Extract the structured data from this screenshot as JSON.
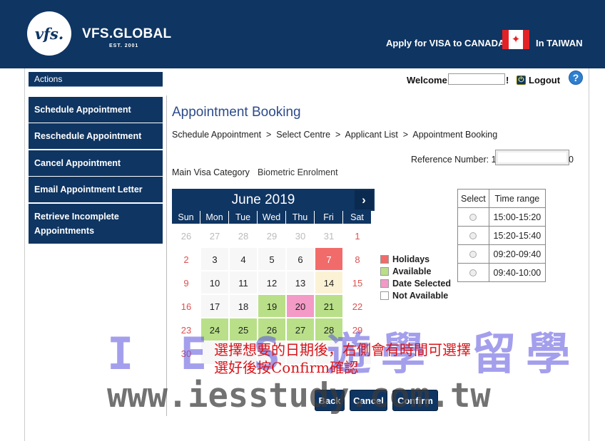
{
  "header": {
    "logo_text": "vfs.",
    "brand": "VFS.GLOBAL",
    "brand_sub": "EST. 2001",
    "apply_text": "Apply for VISA to CANADA",
    "flag_glyph": "✦",
    "in_text": "In TAIWAN",
    "bg_color": "#0f3562"
  },
  "sidebar": {
    "heading": "Actions",
    "items": [
      {
        "label": "Schedule Appointment"
      },
      {
        "label": "Reschedule Appointment"
      },
      {
        "label": "Cancel Appointment"
      },
      {
        "label": "Email Appointment Letter"
      },
      {
        "label": "Retrieve Incomplete Appointments"
      }
    ]
  },
  "topbar": {
    "welcome": "Welcome",
    "exclaim": "!",
    "logout_icon": "power-icon",
    "logout_glyph": "⏻",
    "logout": "Logout",
    "help_glyph": "?"
  },
  "page": {
    "title": "Appointment Booking",
    "breadcrumb": "Schedule Appointment  >  Select Centre  >  Applicant List  >  Appointment Booking",
    "reference_label": "Reference Number:",
    "reference_prefix": "1",
    "reference_suffix": "0",
    "main_visa_label": "Main Visa Category",
    "main_visa_value": "Biometric Enrolment"
  },
  "calendar": {
    "month": "June 2019",
    "next_glyph": "›",
    "weekdays": [
      "Sun",
      "Mon",
      "Tue",
      "Wed",
      "Thu",
      "Fri",
      "Sat"
    ],
    "weeks": [
      [
        {
          "d": "26",
          "s": "other"
        },
        {
          "d": "27",
          "s": "other"
        },
        {
          "d": "28",
          "s": "other"
        },
        {
          "d": "29",
          "s": "other"
        },
        {
          "d": "30",
          "s": "other"
        },
        {
          "d": "31",
          "s": "other"
        },
        {
          "d": "1",
          "s": "weekend"
        }
      ],
      [
        {
          "d": "2",
          "s": "weekend"
        },
        {
          "d": "3",
          "s": "na"
        },
        {
          "d": "4",
          "s": "na"
        },
        {
          "d": "5",
          "s": "na"
        },
        {
          "d": "6",
          "s": "na"
        },
        {
          "d": "7",
          "s": "holiday"
        },
        {
          "d": "8",
          "s": "weekend"
        }
      ],
      [
        {
          "d": "9",
          "s": "weekend"
        },
        {
          "d": "10",
          "s": "na"
        },
        {
          "d": "11",
          "s": "na"
        },
        {
          "d": "12",
          "s": "na"
        },
        {
          "d": "13",
          "s": "na"
        },
        {
          "d": "14",
          "s": "today"
        },
        {
          "d": "15",
          "s": "weekend"
        }
      ],
      [
        {
          "d": "16",
          "s": "weekend"
        },
        {
          "d": "17",
          "s": "na"
        },
        {
          "d": "18",
          "s": "na"
        },
        {
          "d": "19",
          "s": "avail"
        },
        {
          "d": "20",
          "s": "selected"
        },
        {
          "d": "21",
          "s": "avail"
        },
        {
          "d": "22",
          "s": "weekend"
        }
      ],
      [
        {
          "d": "23",
          "s": "weekend"
        },
        {
          "d": "24",
          "s": "avail"
        },
        {
          "d": "25",
          "s": "avail"
        },
        {
          "d": "26",
          "s": "avail"
        },
        {
          "d": "27",
          "s": "avail"
        },
        {
          "d": "28",
          "s": "avail"
        },
        {
          "d": "29",
          "s": "weekend"
        }
      ],
      [
        {
          "d": "30",
          "s": "weekend"
        },
        {
          "d": "",
          "s": "na"
        },
        {
          "d": "",
          "s": "na"
        },
        {
          "d": "",
          "s": "na"
        },
        {
          "d": "",
          "s": "na"
        },
        {
          "d": "",
          "s": "na"
        },
        {
          "d": "",
          "s": "na"
        }
      ]
    ]
  },
  "legend": [
    {
      "label": "Holidays",
      "color": "#f26b6b"
    },
    {
      "label": "Available",
      "color": "#b9e089"
    },
    {
      "label": "Date Selected",
      "color": "#f39ac6"
    },
    {
      "label": "Not Available",
      "color": "#ffffff"
    }
  ],
  "time_table": {
    "headers": [
      "Select",
      "Time range"
    ],
    "slots": [
      "15:00-15:20",
      "15:20-15:40",
      "09:20-09:40",
      "09:40-10:00"
    ]
  },
  "buttons": {
    "back": "Back",
    "cancel": "Cancel",
    "confirm": "Confirm"
  },
  "overlay": {
    "watermark": "I E S 遊學 留學",
    "watermark_url": "www.iesstudy.com.tw",
    "note_line1": "選擇想要的日期後，右側會有時間可選擇",
    "note_line2": "選好後按Confirm確認"
  }
}
